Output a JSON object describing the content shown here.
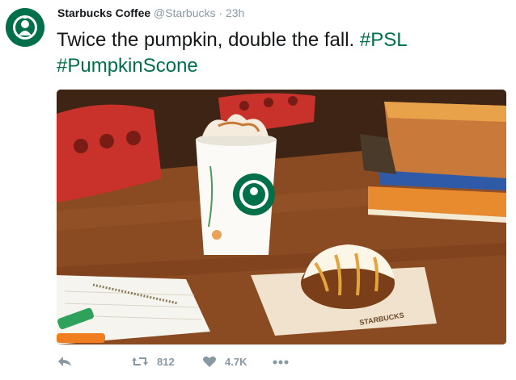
{
  "tweet": {
    "display_name": "Starbucks Coffee",
    "handle": "@Starbucks",
    "separator": "·",
    "timestamp": "23h",
    "text_plain": "Twice the pumpkin, double the fall. ",
    "hashtag_1": "#PSL",
    "hashtag_2": "#PumpkinScone",
    "avatar_icon": "starbucks-siren-logo-icon",
    "media_description_icon": "pumpkin-latte-scone-photo",
    "cup_brand": "STARBUCKS"
  },
  "actions": {
    "reply_icon": "reply-icon",
    "retweet_icon": "retweet-icon",
    "retweet_count": "812",
    "like_icon": "heart-icon",
    "like_count": "4.7K",
    "more_icon": "more-dots-icon"
  },
  "colors": {
    "brand_green": "#00704a",
    "muted_gray": "#8899a6",
    "text": "#14171a"
  }
}
